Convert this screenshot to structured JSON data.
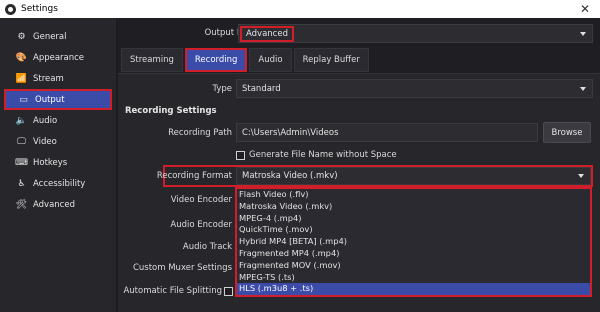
{
  "window": {
    "title": "Settings"
  },
  "sidebar": {
    "items": [
      {
        "label": "General",
        "icon": "gear-icon"
      },
      {
        "label": "Appearance",
        "icon": "palette-icon"
      },
      {
        "label": "Stream",
        "icon": "antenna-icon"
      },
      {
        "label": "Output",
        "icon": "output-icon"
      },
      {
        "label": "Audio",
        "icon": "speaker-icon"
      },
      {
        "label": "Video",
        "icon": "monitor-icon"
      },
      {
        "label": "Hotkeys",
        "icon": "keyboard-icon"
      },
      {
        "label": "Accessibility",
        "icon": "accessibility-icon"
      },
      {
        "label": "Advanced",
        "icon": "wrench-icon"
      }
    ],
    "active": "Output"
  },
  "output_mode": {
    "label": "Output Mode",
    "value": "Advanced"
  },
  "tabs": [
    "Streaming",
    "Recording",
    "Audio",
    "Replay Buffer"
  ],
  "active_tab": "Recording",
  "type": {
    "label": "Type",
    "value": "Standard"
  },
  "section_title": "Recording Settings",
  "recording_path": {
    "label": "Recording Path",
    "value": "C:\\Users\\Admin\\Videos",
    "browse_label": "Browse"
  },
  "generate_filename": {
    "label": "Generate File Name without Space",
    "checked": false
  },
  "recording_format": {
    "label": "Recording Format",
    "value": "Matroska Video (.mkv)",
    "options": [
      "Flash Video (.flv)",
      "Matroska Video (.mkv)",
      "MPEG-4 (.mp4)",
      "QuickTime (.mov)",
      "Hybrid MP4 [BETA] (.mp4)",
      "Fragmented MP4 (.mp4)",
      "Fragmented MOV (.mov)",
      "MPEG-TS (.ts)",
      "HLS (.m3u8 + .ts)"
    ],
    "highlighted": "HLS (.m3u8 + .ts)"
  },
  "video_encoder": {
    "label": "Video Encoder"
  },
  "audio_encoder": {
    "label": "Audio Encoder"
  },
  "audio_track": {
    "label": "Audio Track"
  },
  "custom_muxer": {
    "label": "Custom Muxer Settings"
  },
  "auto_split": {
    "label": "Automatic File Splitting",
    "checked": false
  },
  "colors": {
    "accent": "#3b4ba8",
    "highlight_border": "#d21d2b",
    "background": "#1f1f23",
    "panel": "#26262b"
  }
}
